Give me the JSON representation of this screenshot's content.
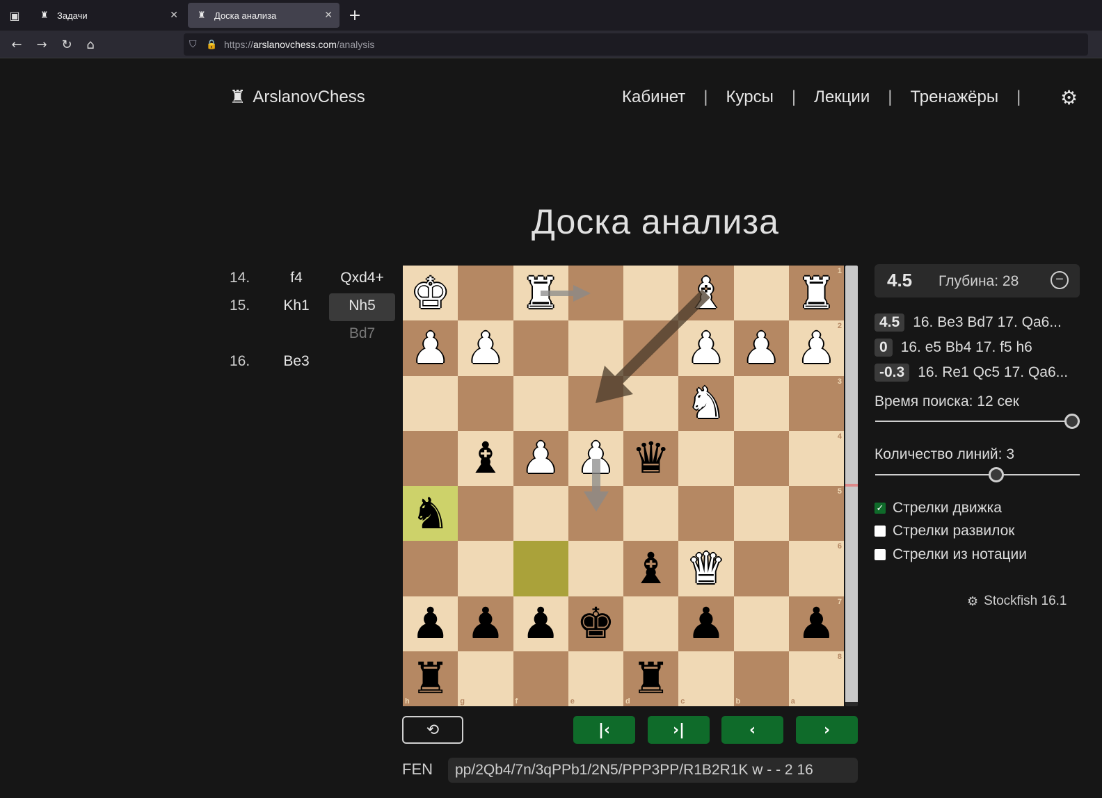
{
  "browser": {
    "tabs": [
      {
        "title": "Задачи",
        "active": false
      },
      {
        "title": "Доска анализа",
        "active": true
      }
    ],
    "url_prefix": "https://",
    "url_host": "arslanovchess.com",
    "url_path": "/analysis"
  },
  "site": {
    "logo_text": "ArslanovChess",
    "nav": [
      "Кабинет",
      "Курсы",
      "Лекции",
      "Тренажёры"
    ],
    "page_title": "Доска анализа"
  },
  "notation": [
    {
      "num": "14.",
      "white": "f4",
      "black": "Qxd4+",
      "black_state": "normal"
    },
    {
      "num": "15.",
      "white": "Kh1",
      "black": "Nh5",
      "black_state": "selected"
    },
    {
      "num": "",
      "white": "",
      "black": "Bd7",
      "black_state": "variation"
    },
    {
      "num": "16.",
      "white": "Be3",
      "black": "",
      "black_state": "normal"
    }
  ],
  "board": {
    "orientation": "black",
    "ranks": [
      [
        "K",
        "",
        "R",
        "",
        "",
        "B",
        "",
        "R"
      ],
      [
        "P",
        "P",
        "",
        "",
        "",
        "P",
        "P",
        "P"
      ],
      [
        "",
        "",
        "",
        "",
        "",
        "N",
        "",
        ""
      ],
      [
        "",
        "b",
        "P",
        "P",
        "q",
        "",
        "",
        ""
      ],
      [
        "n",
        "",
        "",
        "",
        "",
        "",
        "",
        ""
      ],
      [
        "",
        "",
        "",
        "",
        "b",
        "Q",
        "",
        ""
      ],
      [
        "p",
        "p",
        "p",
        "k",
        "",
        "p",
        "",
        "p"
      ],
      [
        "r",
        "",
        "",
        "",
        "r",
        "",
        "",
        ""
      ]
    ],
    "rank_labels": [
      "1",
      "2",
      "3",
      "4",
      "5",
      "6",
      "7",
      "8"
    ],
    "file_labels": [
      "h",
      "g",
      "f",
      "e",
      "d",
      "c",
      "b",
      "a"
    ],
    "highlight_from": [
      4,
      0
    ],
    "highlight_to": [
      5,
      2
    ],
    "eval_white_fraction": 0.99
  },
  "controls": {
    "flip_icon": "refresh-icon",
    "nav_icons": [
      "first-icon",
      "last-icon",
      "prev-icon",
      "next-icon"
    ],
    "fen_label": "FEN",
    "fen_value": "pp/2Qb4/7n/3qPPb1/2N5/PPP3PP/R1B2R1K w - - 2 16"
  },
  "engine": {
    "score": "4.5",
    "depth_label": "Глубина: 28",
    "lines": [
      {
        "eval": "4.5",
        "moves": "16. Be3 Bd7 17. Qa6..."
      },
      {
        "eval": "0",
        "moves": "16. e5 Bb4 17. f5 h6"
      },
      {
        "eval": "-0.3",
        "moves": "16. Re1 Qc5 17. Qa6..."
      }
    ],
    "search_time_label": "Время поиска: 12 сек",
    "search_time_fraction": 1.0,
    "lines_count_label": "Количество линий: 3",
    "lines_count_fraction": 0.6,
    "checkboxes": [
      {
        "label": "Стрелки движка",
        "checked": true
      },
      {
        "label": "Стрелки развилок",
        "checked": false
      },
      {
        "label": "Стрелки из нотации",
        "checked": false
      }
    ],
    "engine_name": "Stockfish 16.1"
  },
  "colors": {
    "light_square": "#f0d9b5",
    "dark_square": "#b58863",
    "accent_green": "#0f6b2a"
  }
}
